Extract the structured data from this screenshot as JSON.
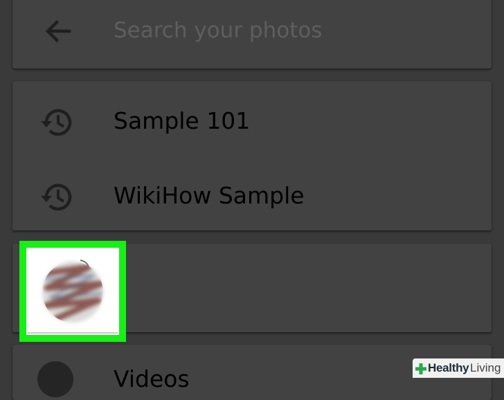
{
  "search": {
    "placeholder": "Search your photos",
    "back_icon": "arrow-back-icon"
  },
  "recent_searches": [
    {
      "label": "Sample 101",
      "icon": "history-icon"
    },
    {
      "label": "WikiHow Sample",
      "icon": "history-icon"
    }
  ],
  "people": {
    "highlight_color": "#19ee19"
  },
  "videos": {
    "label": "Videos",
    "icon": "video-play-icon"
  },
  "watermark": {
    "bold": "Healthy",
    "light": "Living",
    "icon": "plus-cross-icon"
  },
  "colors": {
    "background": "#3a3a3a",
    "card": "#424242",
    "text": "#000000",
    "placeholder": "#5e5e5e",
    "icon": "#1f1f1f"
  }
}
